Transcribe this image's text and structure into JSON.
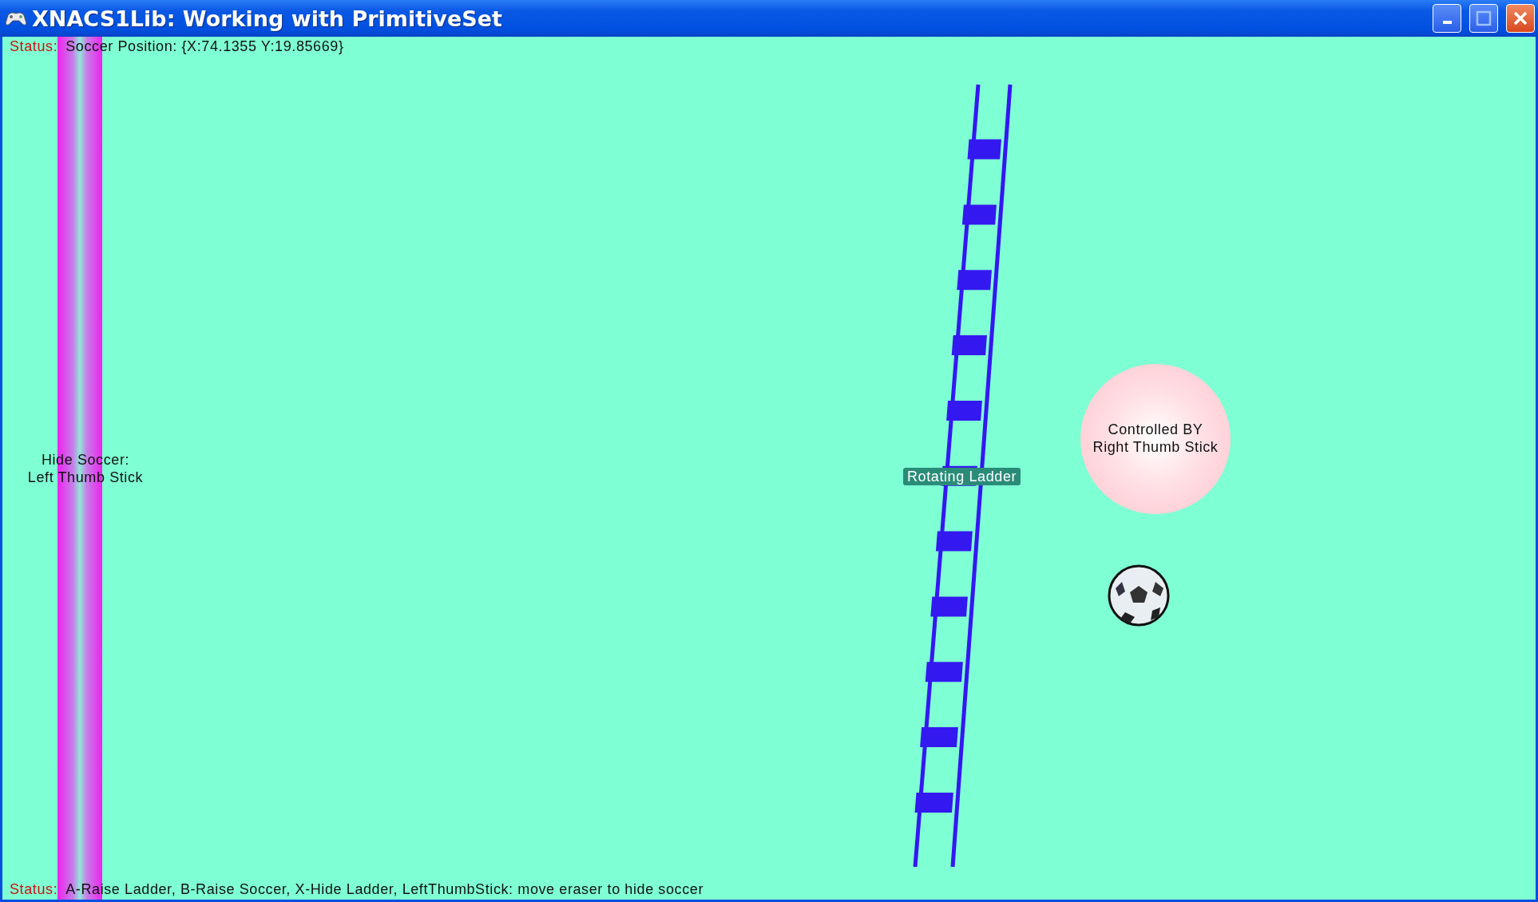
{
  "window": {
    "title": "XNACS1Lib: Working with PrimitiveSet"
  },
  "status_top": {
    "label": "Status:",
    "text": "Soccer Position: {X:74.1355  Y:19.85669}"
  },
  "eraser": {
    "label": "Hide Soccer:\nLeft Thumb Stick"
  },
  "ladder": {
    "label": "Rotating Ladder"
  },
  "circle": {
    "label": "Controlled BY\nRight Thumb Stick"
  },
  "status_bottom": {
    "label": "Status:",
    "text": "A-Raise Ladder, B-Raise Soccer, X-Hide Ladder, LeftThumbStick: move eraser to hide soccer"
  }
}
